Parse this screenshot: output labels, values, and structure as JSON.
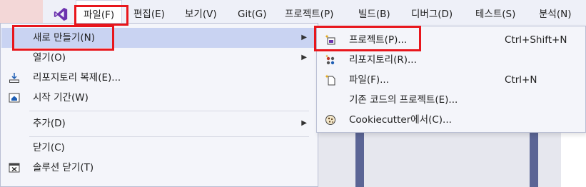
{
  "menubar": {
    "items": [
      {
        "label": "파일(F)"
      },
      {
        "label": "편집(E)"
      },
      {
        "label": "보기(V)"
      },
      {
        "label": "Git(G)"
      },
      {
        "label": "프로젝트(P)"
      },
      {
        "label": "빌드(B)"
      },
      {
        "label": "디버그(D)"
      },
      {
        "label": "테스트(S)"
      },
      {
        "label": "분석(N)"
      }
    ]
  },
  "file_menu": {
    "new": "새로 만들기(N)",
    "open": "열기(O)",
    "clone": "리포지토리 복제(E)...",
    "start_window": "시작 기간(W)",
    "add": "추가(D)",
    "close": "닫기(C)",
    "close_solution": "솔루션 닫기(T)"
  },
  "new_submenu": {
    "items": [
      {
        "label": "프로젝트(P)...",
        "shortcut": "Ctrl+Shift+N"
      },
      {
        "label": "리포지토리(R)...",
        "shortcut": ""
      },
      {
        "label": "파일(F)...",
        "shortcut": "Ctrl+N"
      },
      {
        "label": "기존 코드의 프로젝트(E)...",
        "shortcut": ""
      },
      {
        "label": "Cookiecutter에서(C)...",
        "shortcut": ""
      }
    ]
  },
  "colors": {
    "highlight": "#c9d3f2",
    "annotation_red": "#e8161c",
    "vs_purple": "#6c33af"
  }
}
